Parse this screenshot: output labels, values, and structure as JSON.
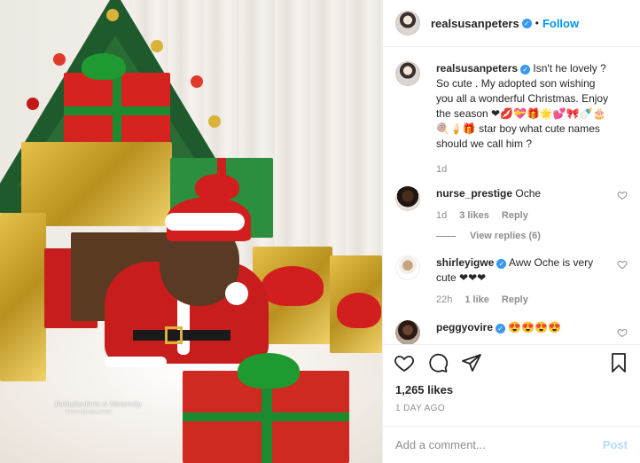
{
  "header": {
    "username": "realsusanpeters",
    "verified_symbol": "✓",
    "separator": "•",
    "follow_label": "Follow"
  },
  "caption": {
    "username": "realsusanpeters",
    "text": "Isn't he lovely ? So cute . My adopted son wishing you all a wonderful Christmas. Enjoy the season ❤💋💝🎁🌟💕🎀🍼🎂🍭🍦🎁 star boy what cute names should we call him ?",
    "time": "1d"
  },
  "comments": [
    {
      "username": "nurse_prestige",
      "verified": false,
      "text": "Oche",
      "time": "1d",
      "likes": "3 likes",
      "reply_label": "Reply",
      "view_replies": "View replies (6)"
    },
    {
      "username": "shirleyigwe",
      "verified": true,
      "text": "Aww Oche is very cute ❤❤❤",
      "time": "22h",
      "likes": "1 like",
      "reply_label": "Reply"
    },
    {
      "username": "peggyovire",
      "verified": true,
      "text": "😍😍😍😍"
    }
  ],
  "likes_count": "1,265 likes",
  "post_date": "1 DAY AGO",
  "add_comment": {
    "placeholder": "Add a comment...",
    "post_label": "Post"
  },
  "photo": {
    "watermark_line1": "Roshabeeform & Maternity",
    "watermark_line2": "PHOTOGRAPHY"
  },
  "icons": [
    "heart-icon",
    "comment-icon",
    "share-icon",
    "bookmark-icon",
    "verified-badge-icon"
  ],
  "colors": {
    "link_blue": "#0095f6",
    "verified_blue": "#3897f0",
    "muted_gray": "#8e8e8e",
    "post_disabled": "#b3dbff"
  }
}
